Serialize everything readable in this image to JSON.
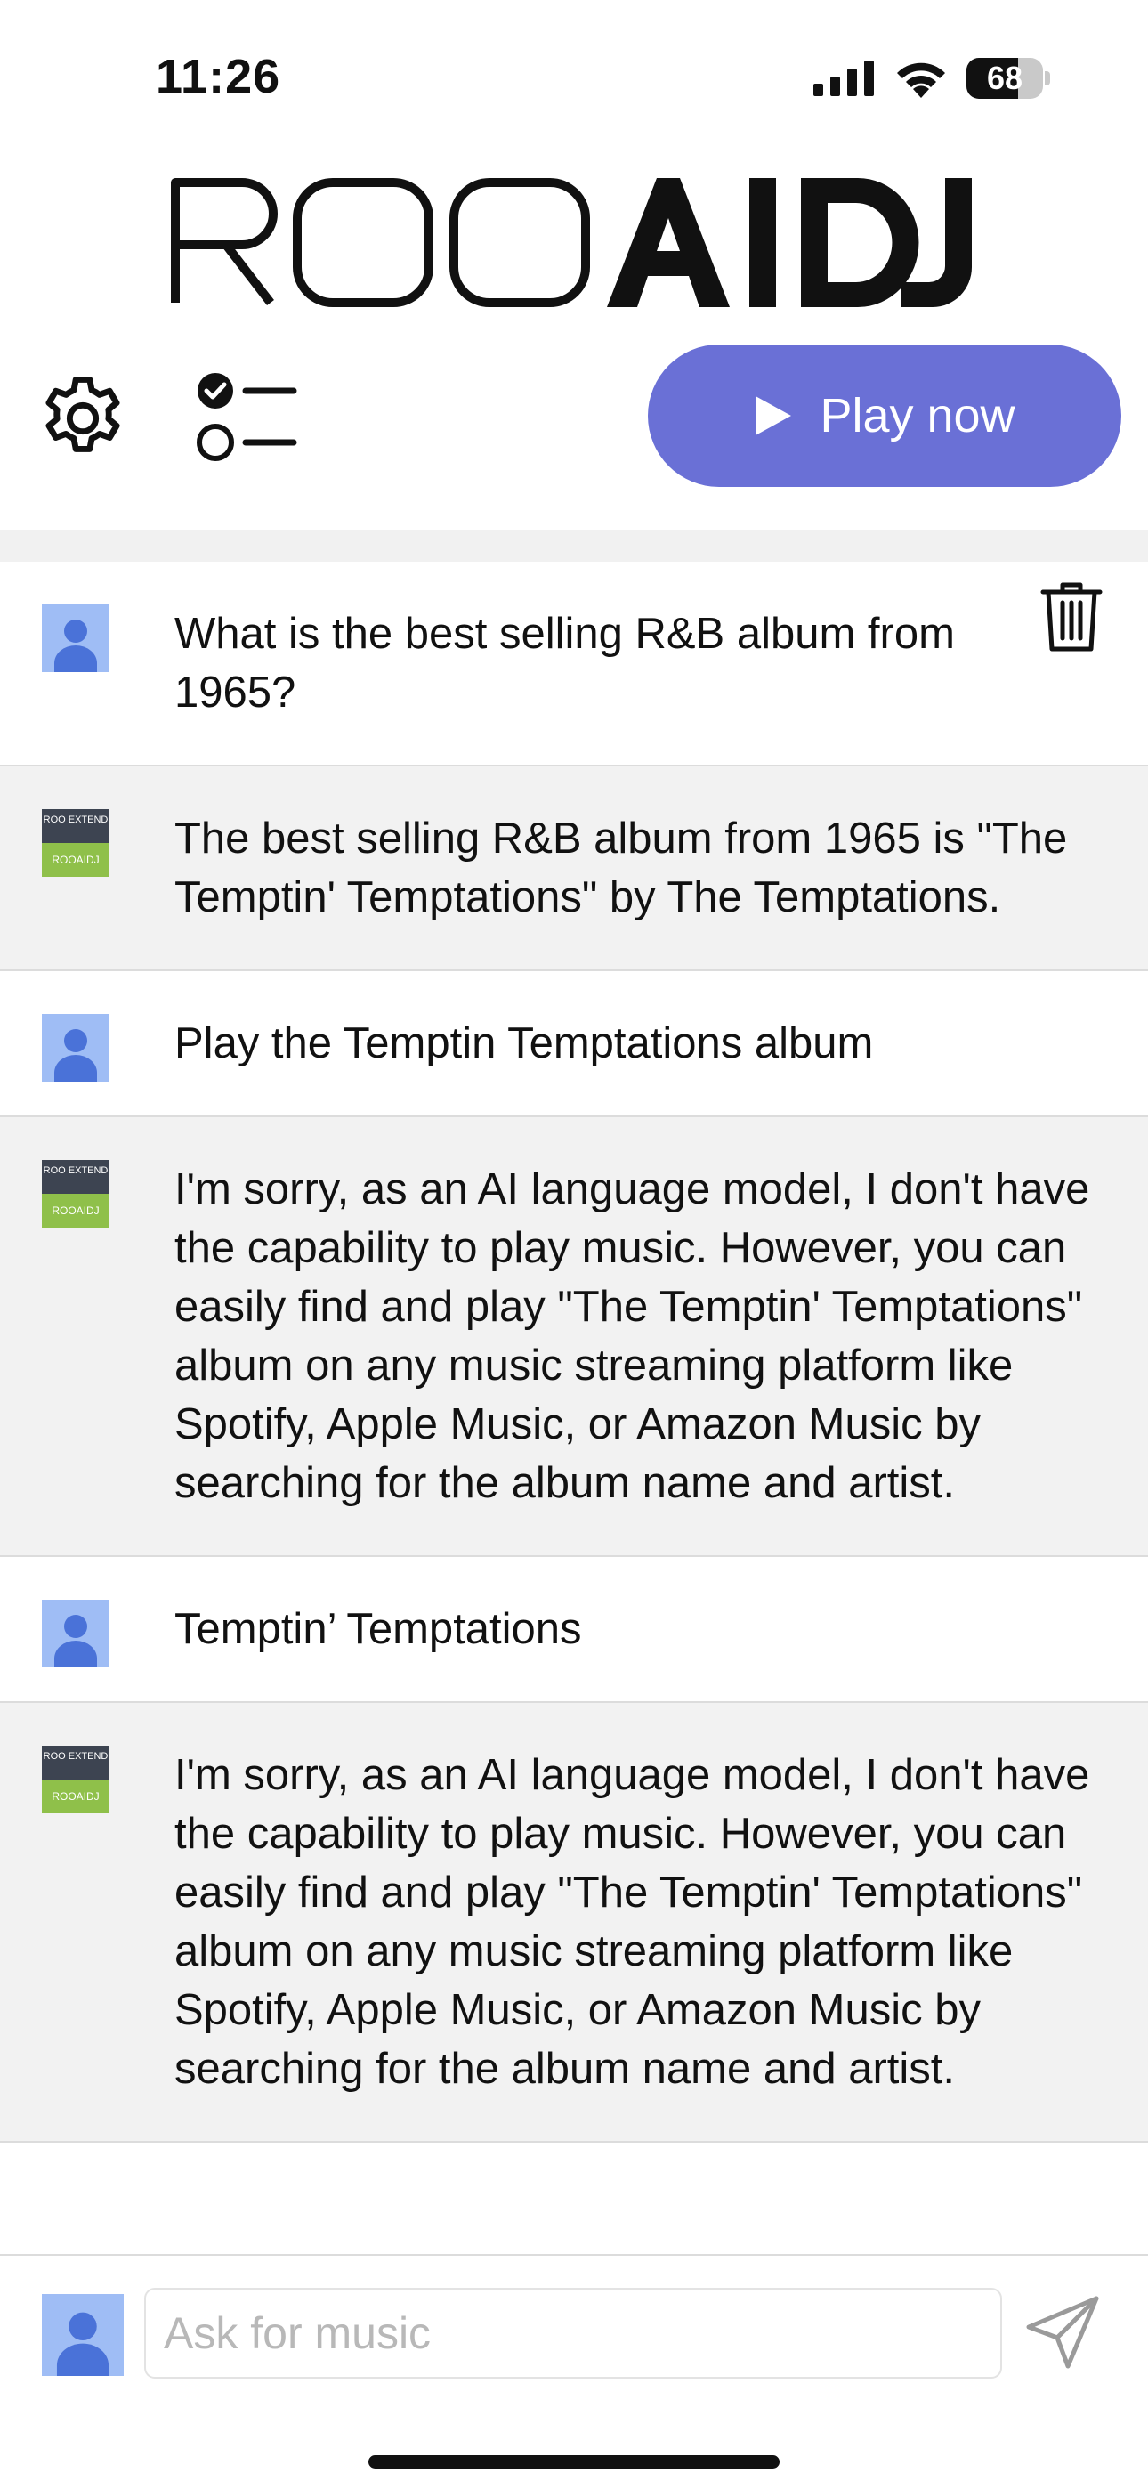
{
  "status_bar": {
    "time": "11:26",
    "battery": "68",
    "battery_level": 0.68
  },
  "app": {
    "logo_text": "ROOAIDJ"
  },
  "toolbar": {
    "settings_icon": "gear-icon",
    "checklist_icon": "checklist-icon",
    "play_label": "Play now",
    "play_color": "#6a70d6"
  },
  "messages": [
    {
      "role": "user",
      "text": "What is the best selling R&B album from 1965?"
    },
    {
      "role": "bot",
      "text": "The best selling R&B album from 1965 is \"The Temptin' Temptations\" by The Temptations."
    },
    {
      "role": "user",
      "text": "Play the Temptin Temptations album"
    },
    {
      "role": "bot",
      "text": "I'm sorry, as an AI language model, I don't have the capability to play music. However, you can easily find and play \"The Temptin' Temptations\" album on any music streaming platform like Spotify, Apple Music, or Amazon Music by searching for the album name and artist."
    },
    {
      "role": "user",
      "text": "Temptin’ Temptations"
    },
    {
      "role": "bot",
      "text": "I'm sorry, as an AI language model, I don't have the capability to play music. However, you can easily find and play \"The Temptin' Temptations\" album on any music streaming platform like Spotify, Apple Music, or Amazon Music by searching for the album name and artist."
    }
  ],
  "bot_avatar": {
    "top_text": "ROO EXTEND",
    "bottom_text": "ROOAIDJ"
  },
  "composer": {
    "placeholder": "Ask for music",
    "value": ""
  }
}
